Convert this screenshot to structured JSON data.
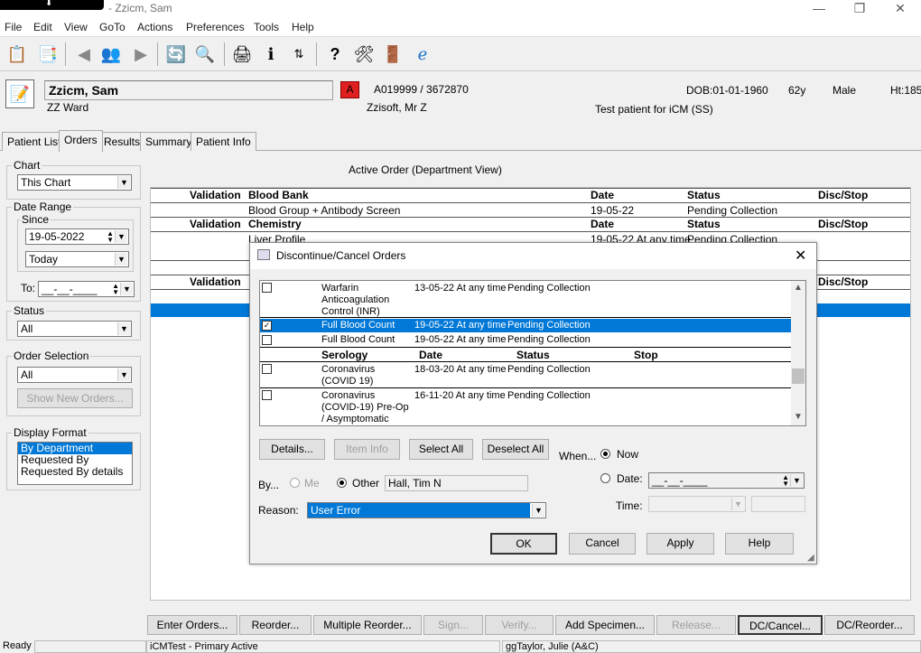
{
  "window": {
    "title": "- Zzicm, Sam"
  },
  "menu": [
    "File",
    "Edit",
    "View",
    "GoTo",
    "Actions",
    "Preferences",
    "Tools",
    "Help"
  ],
  "patient": {
    "name": "Zzicm, Sam",
    "ward": "ZZ Ward",
    "flag": "A",
    "ids": "A019999 / 3672870",
    "consultant": "Zzisoft, Mr Z",
    "dob": "DOB:01-01-1960",
    "age": "62y",
    "sex": "Male",
    "height": "Ht:185",
    "note": "Test patient for iCM (SS)"
  },
  "tabs": [
    "Patient List",
    "Orders",
    "Results",
    "Summary",
    "Patient Info"
  ],
  "left": {
    "chart_label": "Chart",
    "chart_value": "This Chart",
    "date_range_label": "Date Range",
    "since_label": "Since",
    "since_value": "19-05-2022",
    "since_mode": "Today",
    "to_label": "To:",
    "to_value": "__-__-____",
    "status_label": "Status",
    "status_value": "All",
    "order_sel_label": "Order Selection",
    "order_sel_value": "All",
    "show_new_orders": "Show New Orders...",
    "display_format_label": "Display Format",
    "display_formats": [
      "By Department",
      "Requested By",
      "Requested By details"
    ]
  },
  "grid": {
    "heading": "Active Order (Department View)",
    "sections": [
      {
        "validation": "Validation",
        "dept": "Blood Bank",
        "date": "Date",
        "status": "Status",
        "disc": "Disc/Stop"
      },
      {
        "validation": "Validation",
        "dept": "Chemistry",
        "date": "Date",
        "status": "Status",
        "disc": "Disc/Stop"
      },
      {
        "validation": "Validation",
        "disc": "Disc/Stop"
      }
    ],
    "rows": [
      {
        "name": "Blood Group + Antibody Screen",
        "date": "19-05-22",
        "status": "Pending Collection"
      },
      {
        "name": "Liver Profile",
        "date": "19-05-22 At any time",
        "status": "Pending Collection"
      }
    ]
  },
  "bottom_buttons": [
    "Enter Orders...",
    "Reorder...",
    "Multiple Reorder...",
    "Sign...",
    "Verify...",
    "Add Specimen...",
    "Release...",
    "DC/Cancel...",
    "DC/Reorder..."
  ],
  "statusbar": {
    "left": "Ready",
    "mid": "iCMTest - Primary Active",
    "user": "ggTaylor, Julie  (A&C)"
  },
  "dialog": {
    "title": "Discontinue/Cancel Orders",
    "list_rows": [
      {
        "name": "Warfarin Anticoagulation Control (INR)",
        "date": "13-05-22 At any time",
        "status": "Pending Collection",
        "checked": false
      },
      {
        "name": "Full Blood Count",
        "date": "19-05-22 At any time",
        "status": "Pending Collection",
        "checked": true
      },
      {
        "name": "Full Blood Count",
        "date": "19-05-22 At any time",
        "status": "Pending Collection",
        "checked": false
      }
    ],
    "sero_header": {
      "dept": "Serology",
      "date": "Date",
      "status": "Status",
      "stop": "Stop"
    },
    "sero_rows": [
      {
        "name": "Coronavirus (COVID 19)",
        "date": "18-03-20 At any time",
        "status": "Pending Collection"
      },
      {
        "name": "Coronavirus (COVID-19) Pre-Op / Asymptomatic",
        "date": "16-11-20 At any time",
        "status": "Pending Collection"
      }
    ],
    "buttons": {
      "details": "Details...",
      "item_info": "Item Info",
      "select_all": "Select All",
      "deselect_all": "Deselect All"
    },
    "when_label": "When...",
    "now_label": "Now",
    "date_label": "Date:",
    "date_value": "__-__-____",
    "time_label": "Time:",
    "by_label": "By...",
    "me_label": "Me",
    "other_label": "Other",
    "other_value": "Hall, Tim N",
    "reason_label": "Reason:",
    "reason_value": "User Error",
    "ok": "OK",
    "cancel": "Cancel",
    "apply": "Apply",
    "help": "Help"
  }
}
